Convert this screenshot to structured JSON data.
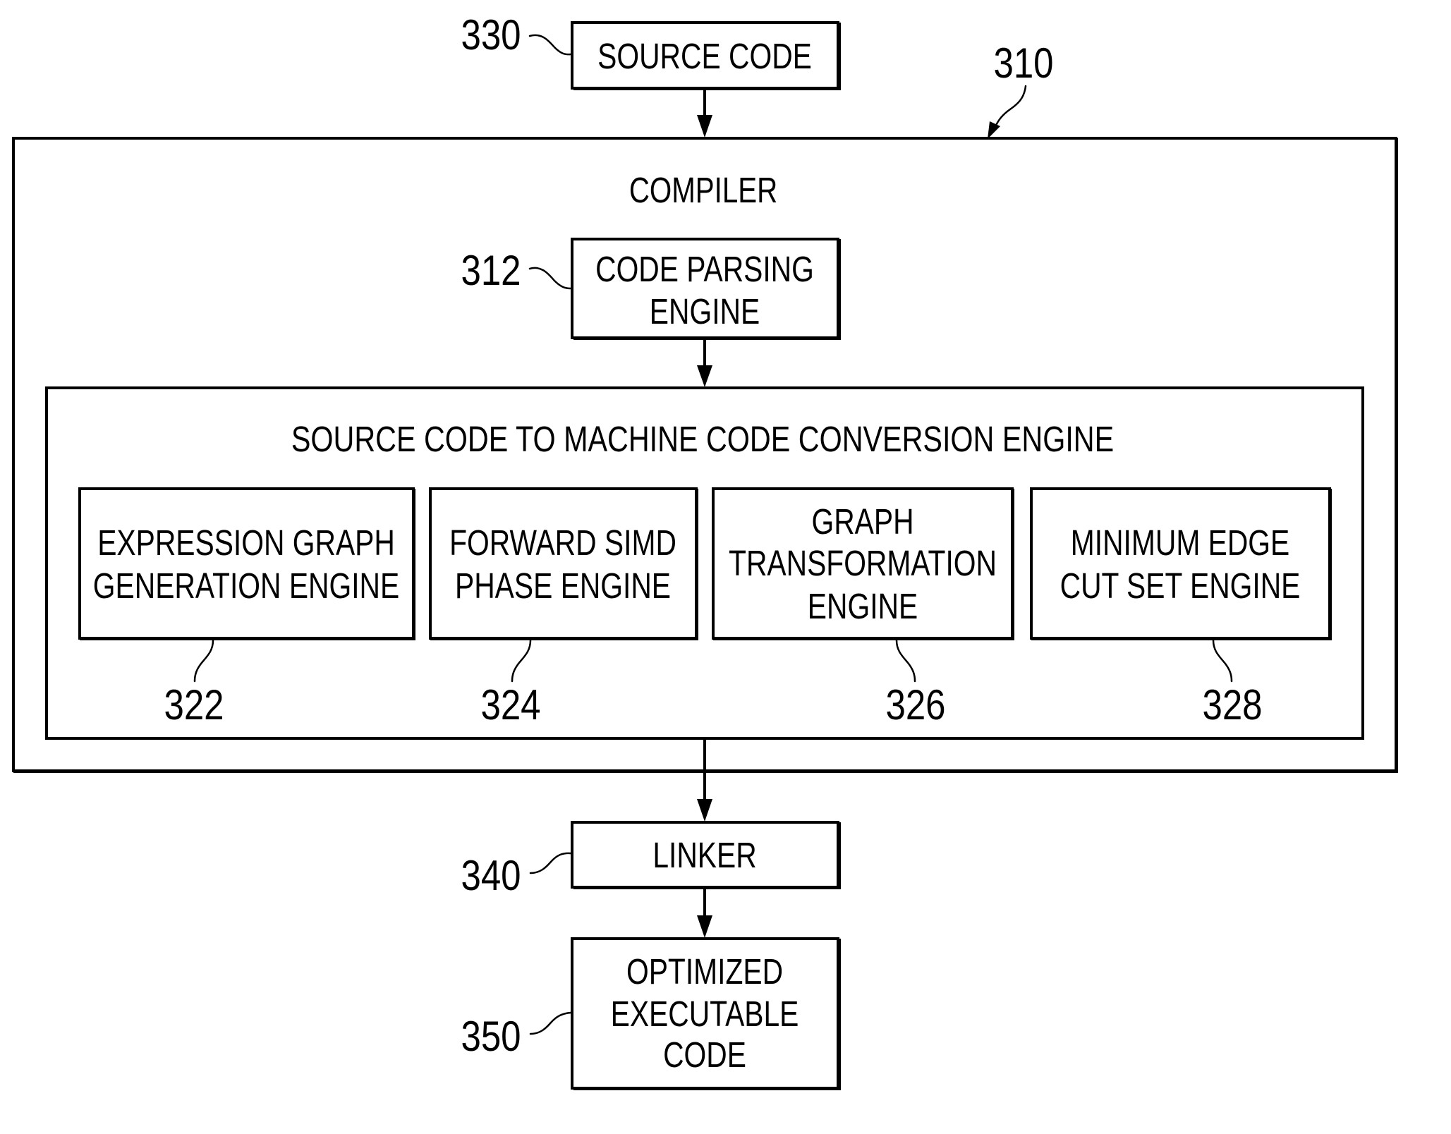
{
  "figure": {
    "source_code": {
      "ref": "330",
      "lines": [
        "SOURCE CODE"
      ]
    },
    "compiler": {
      "ref": "310",
      "title": "COMPILER",
      "code_parsing_engine": {
        "ref": "312",
        "lines": [
          "CODE PARSING",
          "ENGINE"
        ]
      },
      "conversion_engine": {
        "title": "SOURCE CODE TO MACHINE CODE CONVERSION ENGINE",
        "sub_engines": [
          {
            "ref": "322",
            "lines": [
              "EXPRESSION GRAPH",
              "GENERATION ENGINE"
            ]
          },
          {
            "ref": "324",
            "lines": [
              "FORWARD SIMD",
              "PHASE ENGINE"
            ]
          },
          {
            "ref": "326",
            "lines": [
              "GRAPH",
              "TRANSFORMATION",
              "ENGINE"
            ]
          },
          {
            "ref": "328",
            "lines": [
              "MINIMUM EDGE",
              "CUT SET ENGINE"
            ]
          }
        ]
      }
    },
    "linker": {
      "ref": "340",
      "lines": [
        "LINKER"
      ]
    },
    "optimized_executable_code": {
      "ref": "350",
      "lines": [
        "OPTIMIZED",
        "EXECUTABLE",
        "CODE"
      ]
    }
  }
}
